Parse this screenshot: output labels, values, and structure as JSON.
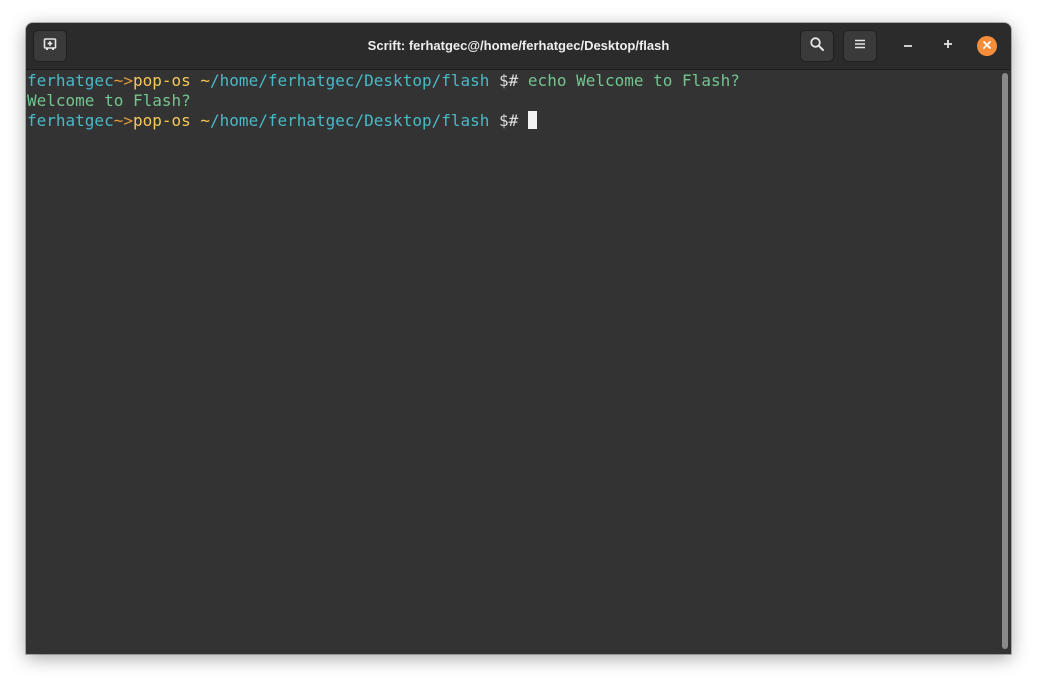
{
  "window": {
    "title": "Scrift: ferhatgec@/home/ferhatgec/Desktop/flash"
  },
  "headerbar": {
    "new_tab_icon": "new-tab-icon",
    "search_icon": "search-icon",
    "menu_icon": "hamburger-menu-icon",
    "minimize_icon": "minimize-icon",
    "maximize_icon": "maximize-icon",
    "close_icon": "close-icon"
  },
  "terminal": {
    "lines": [
      {
        "user": "ferhatgec",
        "sep": "~>",
        "host": "pop-os",
        "tilde": " ~",
        "path": "/home/ferhatgec/Desktop/flash",
        "prompt": " $# ",
        "command": "echo Welcome to Flash?"
      },
      {
        "output": "Welcome to Flash?"
      },
      {
        "user": "ferhatgec",
        "sep": "~>",
        "host": "pop-os",
        "tilde": " ~",
        "path": "/home/ferhatgec/Desktop/flash",
        "prompt": " $# ",
        "command": ""
      }
    ]
  },
  "colors": {
    "user": "#48b9c7",
    "host": "#f7c758",
    "command": "#73c48f",
    "close_button": "#f68d39",
    "background": "#333333"
  }
}
